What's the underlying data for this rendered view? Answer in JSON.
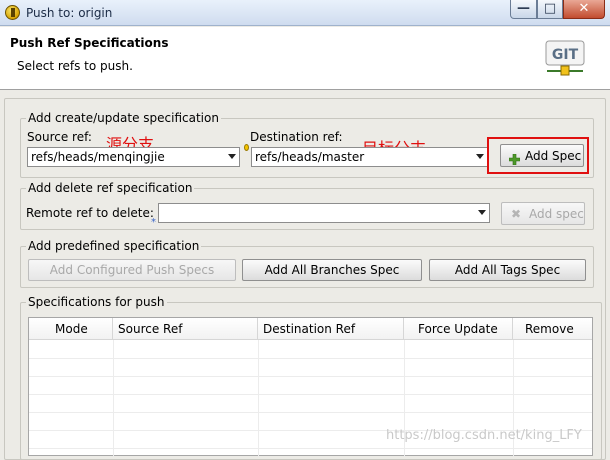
{
  "window": {
    "title": "Push to: origin"
  },
  "titlebar_buttons": {
    "minimize": "—",
    "maximize": "□",
    "close": "✕"
  },
  "header": {
    "title": "Push Ref Specifications",
    "subtitle": "Select refs to push.",
    "logo_text": "GIT"
  },
  "create_update": {
    "group_label": "Add create/update specification",
    "source_label": "Source ref:",
    "source_value": "refs/heads/menqingjie",
    "destination_label": "Destination ref:",
    "destination_value": "refs/heads/master",
    "add_spec_label": "Add Spec",
    "annotation_source": "源分支",
    "annotation_destination": "目标分支"
  },
  "delete": {
    "group_label": "Add delete ref specification",
    "remote_label": "Remote ref to delete:",
    "remote_value": "",
    "add_spec_label": "Add spec"
  },
  "predefined": {
    "group_label": "Add predefined specification",
    "configured_label": "Add Configured Push Specs",
    "all_branches_label": "Add All Branches Spec",
    "all_tags_label": "Add All Tags Spec"
  },
  "specs": {
    "group_label": "Specifications for push",
    "columns": [
      "Mode",
      "Source Ref",
      "Destination Ref",
      "Force Update",
      "Remove"
    ],
    "rows": []
  },
  "watermark": "https://blog.csdn.net/king_LFY",
  "colors": {
    "annotation": "#e01010",
    "highlight_box": "#e01010"
  }
}
